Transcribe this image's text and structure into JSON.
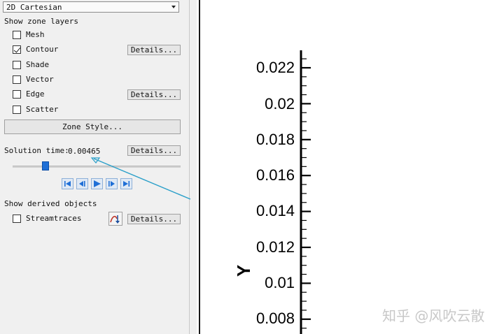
{
  "panel": {
    "view_mode": "2D Cartesian",
    "zone_layers_heading": "Show zone layers",
    "layers": [
      {
        "label": "Mesh",
        "checked": false
      },
      {
        "label": "Contour",
        "checked": true
      },
      {
        "label": "Shade",
        "checked": false
      },
      {
        "label": "Vector",
        "checked": false
      },
      {
        "label": "Edge",
        "checked": false
      },
      {
        "label": "Scatter",
        "checked": false
      }
    ],
    "details_label": "Details...",
    "zone_style_label": "Zone Style...",
    "solution_time_label": "Solution time:",
    "solution_time_value": "0.00465",
    "slider_position": 0.2,
    "playback_buttons": [
      "first-frame-icon",
      "step-back-icon",
      "play-icon",
      "step-forward-icon",
      "last-frame-icon"
    ],
    "derived_heading": "Show derived objects",
    "streamtraces_label": "Streamtraces",
    "streamtraces_checked": false,
    "accent_color": "#1f6fd6",
    "annotation_color": "#2a9fc9"
  },
  "plot": {
    "y_axis_title": "Y",
    "y_tick_labels": [
      "0.022",
      "0.02",
      "0.018",
      "0.016",
      "0.014",
      "0.012",
      "0.01",
      "0.008"
    ]
  },
  "watermark": "知乎 @风吹云散"
}
